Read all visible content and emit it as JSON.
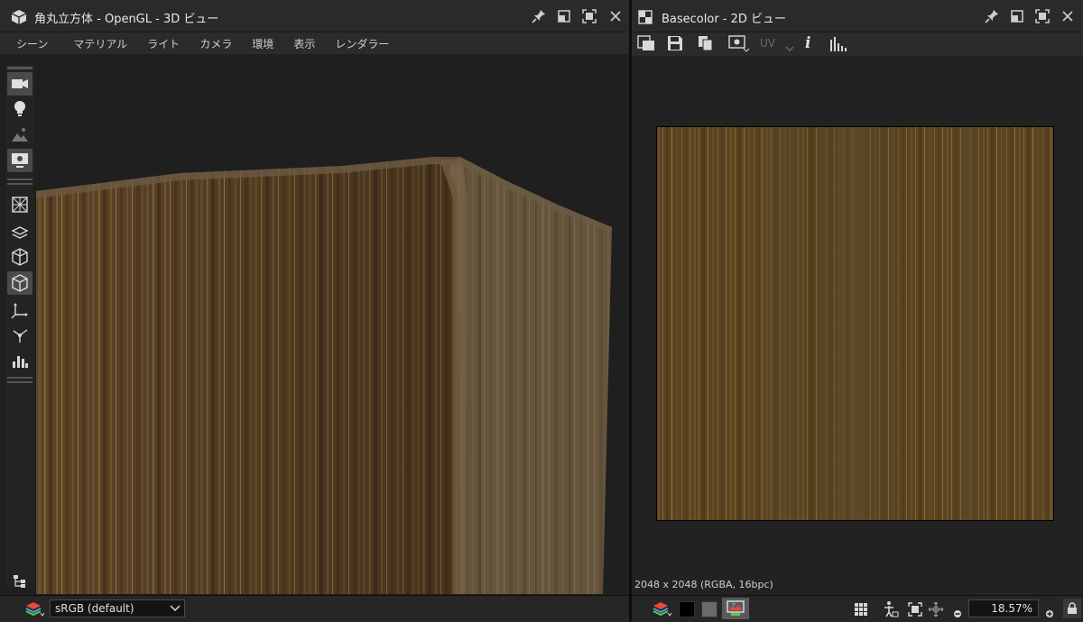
{
  "viewport3d": {
    "title": "角丸立方体 - OpenGL - 3D ビュー",
    "menu": [
      "シーン",
      "マテリアル",
      "ライト",
      "カメラ",
      "環境",
      "表示",
      "レンダラー"
    ],
    "tools": [
      "camera-icon",
      "light-bulb-icon",
      "environment-icon",
      "display-icon",
      "wireframe-icon",
      "layers-icon",
      "cube-icon",
      "cube-solid-icon",
      "axis-icon",
      "transform-icon",
      "histogram-icon"
    ],
    "colorspace": "sRGB (default)"
  },
  "viewport2d": {
    "title": "Basecolor - 2D ビュー",
    "uv_label": "UV",
    "info_text": "i",
    "image_info": "2048 x 2048 (RGBA, 16bpc)",
    "zoom": "18.57%",
    "zoom_suffix": "%"
  }
}
